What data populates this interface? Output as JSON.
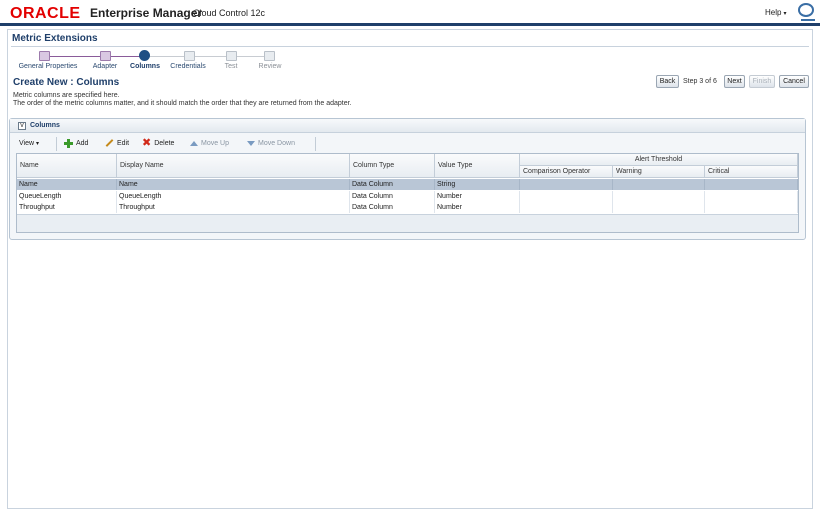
{
  "header": {
    "brand": "ORACLE",
    "product": "Enterprise Manager",
    "subproduct": "Cloud Control 12c",
    "help_label": "Help",
    "help_caret": "▾"
  },
  "page": {
    "title": "Metric Extensions"
  },
  "train": {
    "steps": [
      {
        "label": "General Properties",
        "state": "visited"
      },
      {
        "label": "Adapter",
        "state": "visited"
      },
      {
        "label": "Columns",
        "state": "current"
      },
      {
        "label": "Credentials",
        "state": "future"
      },
      {
        "label": "Test",
        "state": "future"
      },
      {
        "label": "Review",
        "state": "future"
      }
    ]
  },
  "main": {
    "title": "Create New : Columns",
    "desc_line1": "Metric columns are specified here.",
    "desc_line2": "The order of the metric columns matter, and it should match the order that they are returned from the adapter."
  },
  "nav": {
    "back": "Back",
    "step_text": "Step 3 of 6",
    "next": "Next",
    "finish": "Finish",
    "cancel": "Cancel"
  },
  "columns_region": {
    "title": "Columns",
    "toggle": "v",
    "toolbar": {
      "view": "View",
      "view_caret": "▾",
      "add": "Add",
      "edit": "Edit",
      "delete": "Delete",
      "move_up": "Move Up",
      "move_down": "Move Down"
    },
    "table": {
      "headers": {
        "name": "Name",
        "display_name": "Display Name",
        "column_type": "Column Type",
        "value_type": "Value Type",
        "alert_threshold": "Alert Threshold",
        "comparison_operator": "Comparison Operator",
        "warning": "Warning",
        "critical": "Critical"
      },
      "rows": [
        {
          "name": "Name",
          "display_name": "Name",
          "column_type": "Data Column",
          "value_type": "String",
          "comparison_operator": "",
          "warning": "",
          "critical": "",
          "selected": true
        },
        {
          "name": "QueueLength",
          "display_name": "QueueLength",
          "column_type": "Data Column",
          "value_type": "Number",
          "comparison_operator": "",
          "warning": "",
          "critical": "",
          "selected": false
        },
        {
          "name": "Throughput",
          "display_name": "Throughput",
          "column_type": "Data Column",
          "value_type": "Number",
          "comparison_operator": "",
          "warning": "",
          "critical": "",
          "selected": false
        }
      ]
    }
  },
  "colors": {
    "brand_red": "#e30000",
    "header_rule": "#1f3f6a",
    "title_blue": "#1f3f6a",
    "selected_row": "#b9c6d6"
  }
}
